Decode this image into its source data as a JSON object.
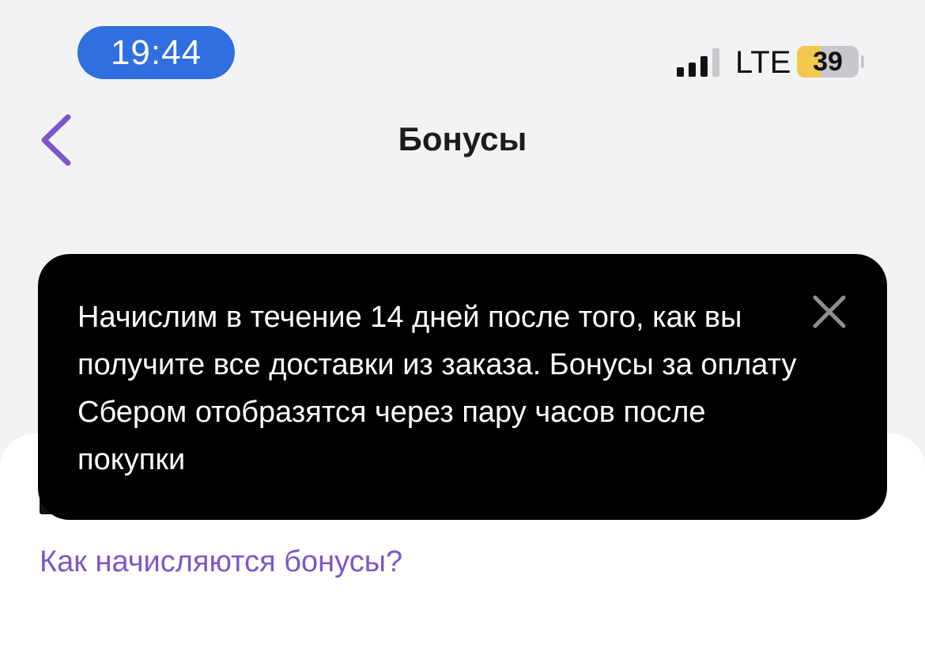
{
  "status_bar": {
    "time": "19:44",
    "network": "LTE",
    "battery_level": "39",
    "battery_fraction": 0.39,
    "signal_bars_active": 3,
    "signal_bars_total": 4
  },
  "header": {
    "title": "Бонусы",
    "back_icon": "chevron-left-icon"
  },
  "tooltip": {
    "text": "Начислим в течение 14 дней после того, как вы получите все доставки из заказа. Бонусы за оплату Сбером отобразятся через пару часов после покупки",
    "close_icon": "close-icon"
  },
  "content": {
    "how_bonuses_link": "Как начисляются бонусы?"
  },
  "colors": {
    "accent": "#7c57c8",
    "time_pill": "#2f6fe0",
    "battery_fill": "#f2c94c",
    "background": "#f2f3f5",
    "tooltip_bg": "#000000"
  }
}
